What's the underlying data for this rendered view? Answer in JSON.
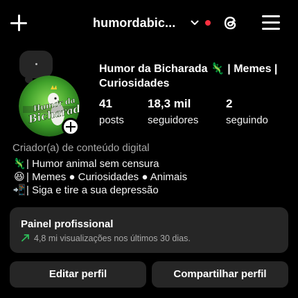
{
  "header": {
    "username": "humordabic...",
    "notification_dot_color": "#ff3040"
  },
  "profile": {
    "display_name": "Humor da Bicharada 🦎 | Memes | Curiosidades",
    "avatar_text_top": "Humor da",
    "avatar_text_bottom": "Bicharada",
    "stats": {
      "posts_count": "41",
      "posts_label": "posts",
      "followers_count": "18,3 mil",
      "followers_label": "seguidores",
      "following_count": "2",
      "following_label": "seguindo"
    },
    "category": "Criador(a) de conteúdo digital",
    "bio": [
      {
        "emoji": "🦎",
        "text": "| Humor animal sem censura"
      },
      {
        "emoji": "😆",
        "text": "| Memes ● Curiosidades ● Animais"
      },
      {
        "emoji": "📲",
        "text": "| Siga e tire a sua depressão"
      }
    ]
  },
  "professional_panel": {
    "title": "Painel profissional",
    "subtitle": "4,8 mi visualizações nos últimos 30 dias.",
    "trend_color": "#2ebd59"
  },
  "actions": {
    "edit_label": "Editar perfil",
    "share_label": "Compartilhar perfil"
  },
  "icons": [
    "plus-icon",
    "chevron-down-icon",
    "threads-icon",
    "menu-icon",
    "trend-icon"
  ]
}
